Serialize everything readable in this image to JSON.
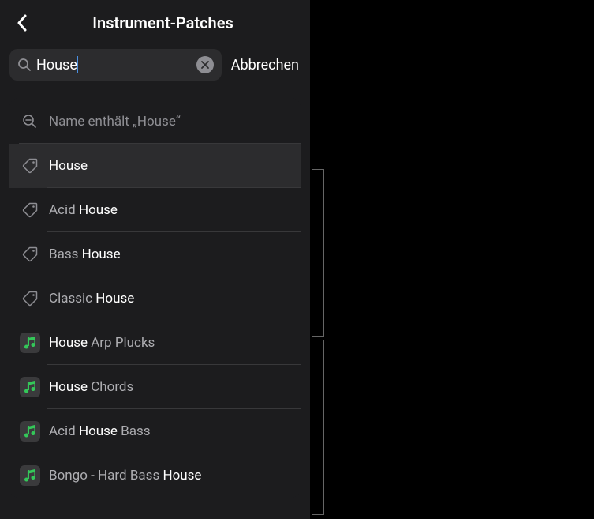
{
  "header": {
    "title": "Instrument-Patches"
  },
  "search": {
    "value": "House",
    "cancel_label": "Abbrechen"
  },
  "results": {
    "header_label": "Name enthält „House“",
    "tags": [
      {
        "prefix": "",
        "match": "House",
        "suffix": ""
      },
      {
        "prefix": "Acid ",
        "match": "House",
        "suffix": ""
      },
      {
        "prefix": "Bass ",
        "match": "House",
        "suffix": ""
      },
      {
        "prefix": "Classic ",
        "match": "House",
        "suffix": ""
      }
    ],
    "patches": [
      {
        "prefix": "",
        "match": "House",
        "suffix": " Arp Plucks"
      },
      {
        "prefix": "",
        "match": "House",
        "suffix": " Chords"
      },
      {
        "prefix": "Acid ",
        "match": "House",
        "suffix": " Bass"
      },
      {
        "prefix": "Bongo - Hard Bass ",
        "match": "House",
        "suffix": ""
      }
    ]
  }
}
